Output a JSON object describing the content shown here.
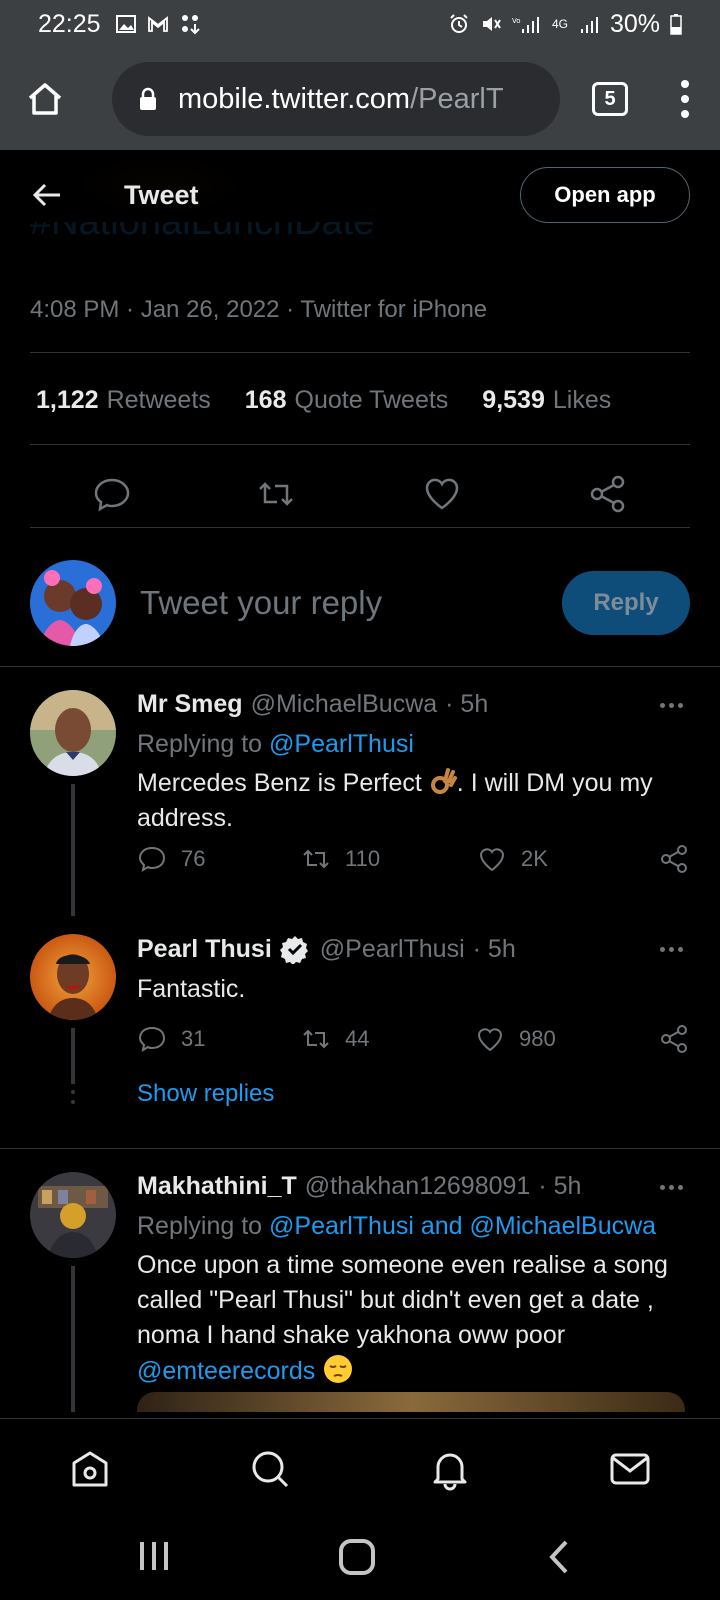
{
  "status_bar": {
    "time": "22:25",
    "battery": "30%",
    "network": "4G"
  },
  "browser": {
    "url_host": "mobile.twitter.com",
    "url_path": "/PearlT",
    "tab_count": "5"
  },
  "header": {
    "title": "Tweet",
    "open_app": "Open app"
  },
  "tweet": {
    "hashtag_partial": "#NationalLunchDate",
    "meta": "4:08 PM · Jan 26, 2022 · Twitter for iPhone",
    "stats": {
      "retweets_num": "1,122",
      "retweets_label": "Retweets",
      "quotes_num": "168",
      "quotes_label": "Quote Tweets",
      "likes_num": "9,539",
      "likes_label": "Likes"
    }
  },
  "reply_box": {
    "placeholder": "Tweet your reply",
    "button": "Reply"
  },
  "replies": [
    {
      "name": "Mr Smeg",
      "handle": "@MichaelBucwa",
      "time": "· 5h",
      "replying_prefix": "Replying to",
      "replying_to": "@PearlThusi",
      "text_a": "Mercedes Benz is Perfect",
      "text_b": ". I will DM you my address.",
      "replies": "76",
      "retweets": "110",
      "likes": "2K"
    },
    {
      "name": "Pearl Thusi",
      "handle": "@PearlThusi",
      "time": "· 5h",
      "text": "Fantastic.",
      "replies": "31",
      "retweets": "44",
      "likes": "980"
    },
    {
      "name": "Makhathini_T",
      "handle": "@thakhan12698091",
      "time": "· 5h",
      "replying_prefix": "Replying to",
      "replying_to": "@PearlThusi and @MichaelBucwa",
      "text": "Once upon a time someone even realise a song called \"Pearl Thusi\" but didn't even get a date , noma I hand shake yakhona oww poor",
      "mention": "@emteerecords"
    }
  ],
  "show_replies": "Show replies",
  "colors": {
    "link": "#1d9bf0",
    "background": "#000000",
    "muted": "#71767b",
    "reply_button": "#0e4d7a"
  }
}
